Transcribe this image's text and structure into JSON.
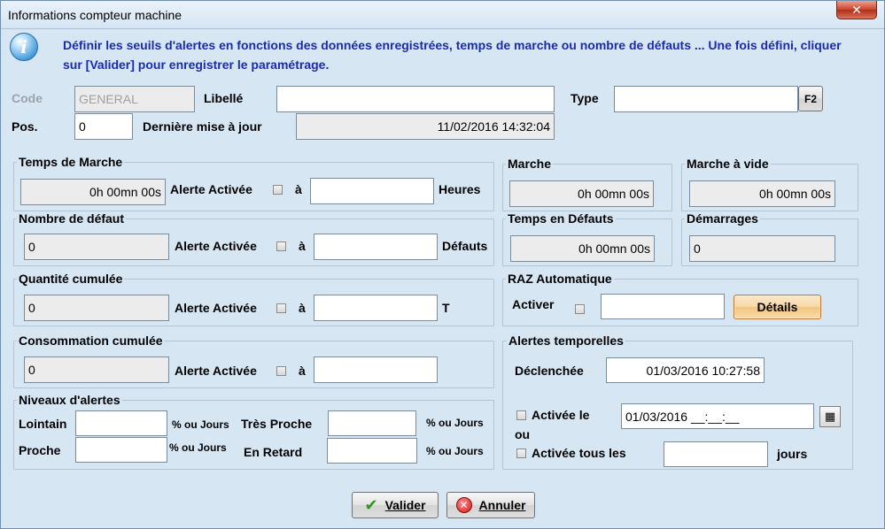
{
  "window": {
    "title": "Informations compteur machine",
    "close": "✕"
  },
  "info": {
    "text": "Définir les seuils d'alertes en fonctions des données enregistrées, temps de marche ou nombre de défauts ... Une fois défini, cliquer sur [Valider] pour enregistrer le paramétrage."
  },
  "header": {
    "code_label": "Code",
    "code_value": "GENERAL",
    "libelle_label": "Libellé",
    "libelle_value": "",
    "type_label": "Type",
    "type_value": "",
    "f2_label": "F2",
    "pos_label": "Pos.",
    "pos_value": "0",
    "maj_label": "Dernière mise à jour",
    "maj_value": "11/02/2016 14:32:04"
  },
  "temps_marche": {
    "title": "Temps de Marche",
    "value": "0h 00mn 00s",
    "alerte": "Alerte Activée",
    "a": "à",
    "seuil": "",
    "unit": "Heures"
  },
  "marche": {
    "title": "Marche",
    "value": "0h 00mn 00s"
  },
  "marche_vide": {
    "title": "Marche à vide",
    "value": "0h 00mn 00s"
  },
  "defaut": {
    "title": "Nombre de défaut",
    "value": "0",
    "alerte": "Alerte Activée",
    "a": "à",
    "seuil": "",
    "unit": "Défauts"
  },
  "temps_defauts": {
    "title": "Temps en Défauts",
    "value": "0h 00mn 00s"
  },
  "demarrages": {
    "title": "Démarrages",
    "value": "0"
  },
  "quantite": {
    "title": "Quantité cumulée",
    "value": "0",
    "alerte": "Alerte Activée",
    "a": "à",
    "seuil": "",
    "unit": "T"
  },
  "raz": {
    "title": "RAZ Automatique",
    "activer": "Activer",
    "value": "",
    "details": "Détails"
  },
  "conso": {
    "title": "Consommation cumulée",
    "value": "0",
    "alerte": "Alerte Activée",
    "a": "à",
    "seuil": ""
  },
  "niveaux": {
    "title": "Niveaux d'alertes",
    "lointain": "Lointain",
    "lointain_unit": "% ou Jours",
    "tres_proche": "Très Proche",
    "tres_proche_unit": "% ou Jours",
    "proche": "Proche",
    "proche_unit": "% ou Jours",
    "en_retard": "En Retard",
    "en_retard_unit": "% ou Jours"
  },
  "alertes_temp": {
    "title": "Alertes temporelles",
    "declenchee": "Déclenchée",
    "declenchee_value": "01/03/2016 10:27:58",
    "activee_le": "Activée le",
    "ou": "ou",
    "activee_le_value": "01/03/2016 __:__:__",
    "activee_tous": "Activée tous les",
    "jours": "jours",
    "jours_value": ""
  },
  "buttons": {
    "valider": "Valider",
    "annuler": "Annuler"
  }
}
